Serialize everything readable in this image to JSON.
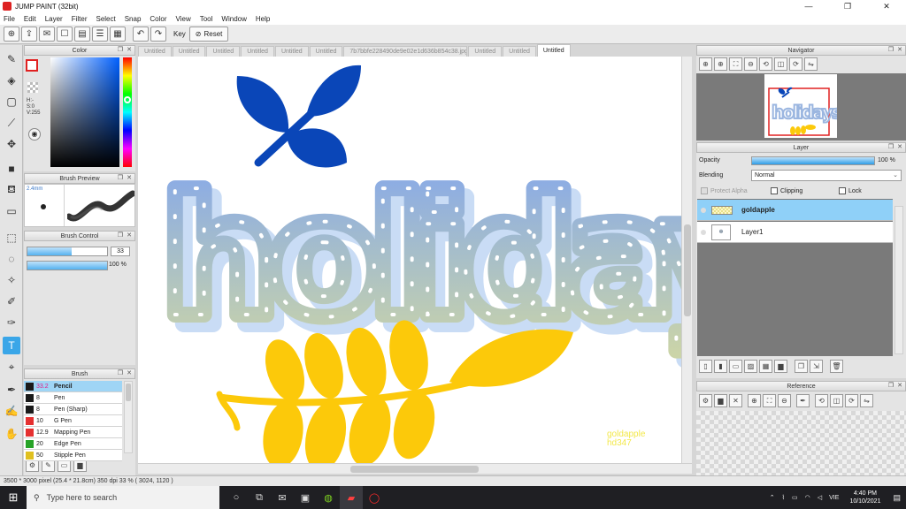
{
  "app": {
    "title": "JUMP PAINT (32bit)"
  },
  "window_controls": {
    "minimize": "—",
    "maximize": "❐",
    "close": "✕"
  },
  "menu": [
    "File",
    "Edit",
    "Layer",
    "Filter",
    "Select",
    "Snap",
    "Color",
    "View",
    "Tool",
    "Window",
    "Help"
  ],
  "toolbar": {
    "key_label": "Key",
    "reset_label": "Reset"
  },
  "tabs": [
    "Untitled",
    "Untitled",
    "Untitled",
    "Untitled",
    "Untitled",
    "Untitled",
    "7b7bbfe228490de9e02e1d636b854c38.jpg",
    "Untitled",
    "Untitled",
    "Untitled"
  ],
  "active_tab_index": 9,
  "color_panel": {
    "title": "Color",
    "readout": [
      "H:-",
      "S:0",
      "V:255"
    ]
  },
  "brush_preview": {
    "title": "Brush Preview",
    "size": "2.4mm"
  },
  "brush_control": {
    "title": "Brush Control",
    "size_value": "33",
    "opacity_value": "100 %",
    "size_fraction": 0.55,
    "opacity_fraction": 1.0
  },
  "brush_panel": {
    "title": "Brush",
    "items": [
      {
        "size": "33.2",
        "name": "Pencil",
        "color": "#1a1a1a",
        "selected": true
      },
      {
        "size": "8",
        "name": "Pen",
        "color": "#1a1a1a"
      },
      {
        "size": "8",
        "name": "Pen (Sharp)",
        "color": "#1a1a1a"
      },
      {
        "size": "10",
        "name": "G Pen",
        "color": "#e53030"
      },
      {
        "size": "12.9",
        "name": "Mapping Pen",
        "color": "#e53030"
      },
      {
        "size": "20",
        "name": "Edge Pen",
        "color": "#27a327"
      },
      {
        "size": "50",
        "name": "Stipple Pen",
        "color": "#e0c020"
      }
    ]
  },
  "navigator": {
    "title": "Navigator"
  },
  "layer_panel": {
    "title": "Layer",
    "opacity_label": "Opacity",
    "opacity_value": "100 %",
    "opacity_fraction": 1.0,
    "blending_label": "Blending",
    "blending_value": "Normal",
    "protect_alpha": "Protect Alpha",
    "clipping": "Clipping",
    "lock": "Lock",
    "layers": [
      {
        "name": "goldapple",
        "selected": true
      },
      {
        "name": "Layer1",
        "selected": false
      }
    ]
  },
  "reference": {
    "title": "Reference"
  },
  "canvas": {
    "word": "holidays",
    "signature_line1": "goldapple",
    "signature_line2": "hd347",
    "leaf_blue": "#0a46b8",
    "leaf_yellow": "#fcc90a"
  },
  "status": "3500 * 3000 pixel   (25.4 * 21.8cm)   350 dpi   33 %   ( 3024, 1120 )",
  "taskbar": {
    "search_placeholder": "Type here to search",
    "lang": "VIE",
    "time": "4:40 PM",
    "date": "10/10/2021"
  }
}
